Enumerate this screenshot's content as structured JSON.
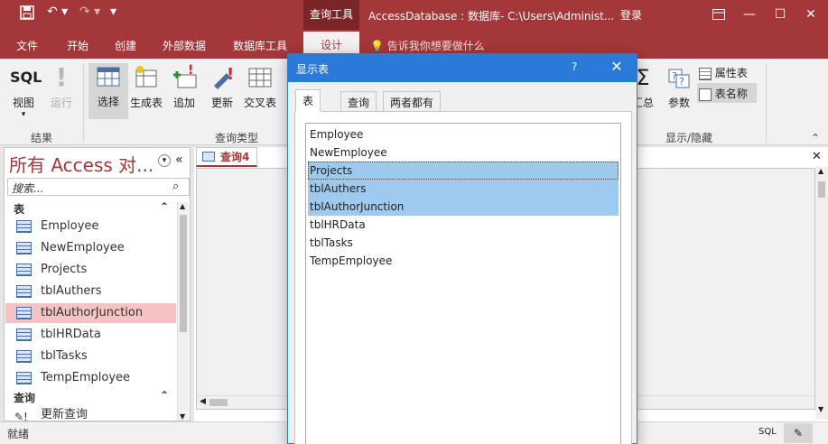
{
  "title_bar": {
    "context_tab": "查询工具",
    "app_title": "AccessDatabase : 数据库- C:\\Users\\Administ...",
    "login": "登录",
    "minimize": "—",
    "maximize": "☐",
    "close": "✕"
  },
  "menu": {
    "items": [
      "文件",
      "开始",
      "创建",
      "外部数据",
      "数据库工具"
    ],
    "active": "设计",
    "tell_me": "告诉我你想要做什么"
  },
  "ribbon": {
    "results": {
      "view": "视图",
      "run": "运行",
      "group": "结果",
      "sql": "SQL"
    },
    "query_type": {
      "select": "选择",
      "make_table": "生成表",
      "append": "追加",
      "update": "更新",
      "crosstab": "交叉表",
      "group": "查询类型"
    },
    "show_hide": {
      "totals": "汇总",
      "params": "参数",
      "property_sheet": "属性表",
      "table_names": "表名称",
      "group": "显示/隐藏"
    }
  },
  "nav": {
    "title": "所有 Access 对...",
    "search_placeholder": "搜索...",
    "tables_header": "表",
    "tables": [
      "Employee",
      "NewEmployee",
      "Projects",
      "tblAuthers",
      "tblAuthorJunction",
      "tblHRData",
      "tblTasks",
      "TempEmployee"
    ],
    "selected_table": "tblAuthorJunction",
    "queries_header": "查询",
    "queries": [
      "更新查询"
    ]
  },
  "document": {
    "tab_label": "查询4"
  },
  "status": {
    "text": "就绪",
    "sql": "SQL"
  },
  "dialog": {
    "title": "显示表",
    "help": "?",
    "close": "✕",
    "tabs": [
      "表",
      "查询",
      "两者都有"
    ],
    "active_tab": "表",
    "items": [
      "Employee",
      "NewEmployee",
      "Projects",
      "tblAuthers",
      "tblAuthorJunction",
      "tblHRData",
      "tblTasks",
      "TempEmployee"
    ],
    "selected_items": [
      "Projects",
      "tblAuthers",
      "tblAuthorJunction"
    ],
    "focused_item": "Projects"
  },
  "colors": {
    "access_red": "#a4373a",
    "dialog_blue": "#2b79d8",
    "selection_blue": "#9fcaf0",
    "nav_selection": "#f5c3c3"
  }
}
